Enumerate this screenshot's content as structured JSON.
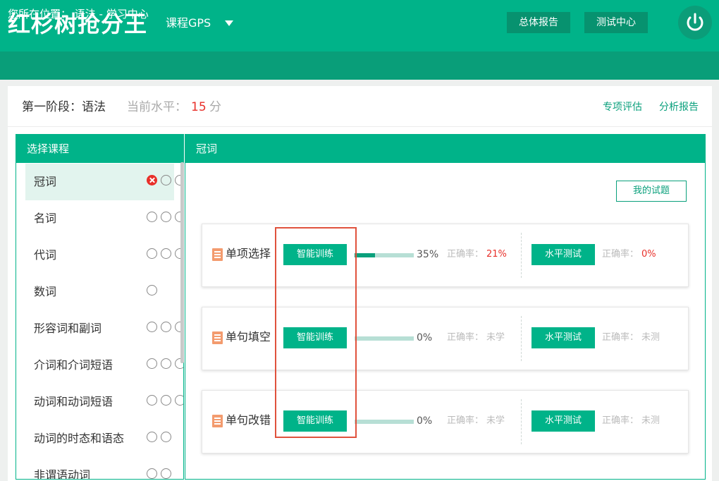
{
  "header": {
    "logo": "红杉树抢分王",
    "gps_label": "课程GPS",
    "report_button": "总体报告",
    "test_center_button": "测试中心"
  },
  "breadcrumb": "您所在位置： 语法 - 学习中心",
  "stage": {
    "title": "第一阶段：语法",
    "level_label": "当前水平：",
    "level_value": "15",
    "level_unit": "分",
    "link_assess": "专项评估",
    "link_report": "分析报告"
  },
  "left_panel": {
    "title": "选择课程",
    "courses": [
      {
        "name": "冠词",
        "dots": [
          "x",
          "o",
          "o"
        ],
        "active": true
      },
      {
        "name": "名词",
        "dots": [
          "o",
          "o",
          "o"
        ]
      },
      {
        "name": "代词",
        "dots": [
          "o",
          "o",
          "o"
        ]
      },
      {
        "name": "数词",
        "dots": [
          "o"
        ]
      },
      {
        "name": "形容词和副词",
        "dots": [
          "o",
          "o",
          "o"
        ]
      },
      {
        "name": "介词和介词短语",
        "dots": [
          "o",
          "o",
          "o"
        ]
      },
      {
        "name": "动词和动词短语",
        "dots": [
          "o",
          "o",
          "o"
        ]
      },
      {
        "name": "动词的时态和语态",
        "dots": [
          "o",
          "o"
        ]
      },
      {
        "name": "非谓语动词",
        "dots": [
          "o",
          "o"
        ]
      }
    ]
  },
  "right_panel": {
    "title": "冠词",
    "my_tests_button": "我的试题",
    "cards": [
      {
        "title": "单项选择",
        "train_label": "智能训练",
        "progress": 0.35,
        "progress_text": "35%",
        "accuracy_label": "正确率：",
        "accuracy_value": "21%",
        "accuracy_highlight": true,
        "test_label": "水平测试",
        "test_accuracy_label": "正确率：",
        "test_accuracy_value": "0%",
        "test_highlight": true
      },
      {
        "title": "单句填空",
        "train_label": "智能训练",
        "progress": 0.0,
        "progress_text": "0%",
        "accuracy_label": "正确率：",
        "accuracy_value": "未学",
        "accuracy_highlight": false,
        "test_label": "水平测试",
        "test_accuracy_label": "正确率：",
        "test_accuracy_value": "未测",
        "test_highlight": false
      },
      {
        "title": "单句改错",
        "train_label": "智能训练",
        "progress": 0.0,
        "progress_text": "0%",
        "accuracy_label": "正确率：",
        "accuracy_value": "未学",
        "accuracy_highlight": false,
        "test_label": "水平测试",
        "test_accuracy_label": "正确率：",
        "test_accuracy_value": "未测",
        "test_highlight": false
      }
    ]
  },
  "colors": {
    "brand": "#00b389",
    "brand_dark": "#099e79",
    "error": "#e8302a",
    "annotation": "#e0523d"
  }
}
